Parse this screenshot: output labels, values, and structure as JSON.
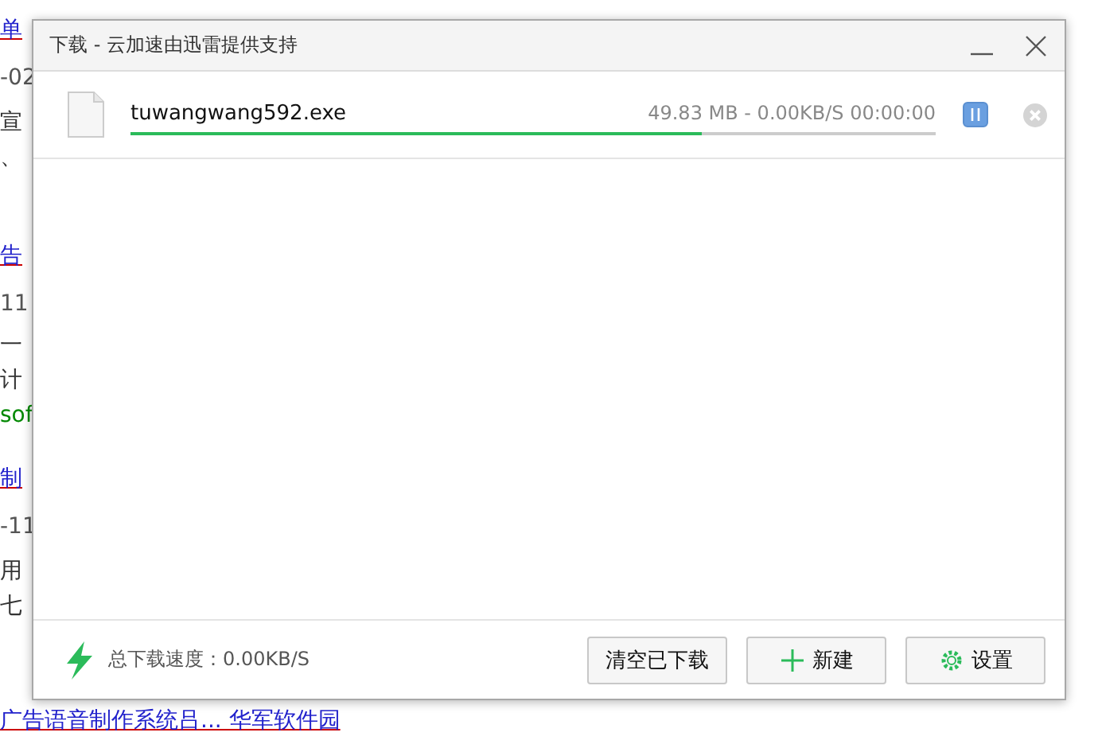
{
  "background_page": {
    "lines": [
      {
        "text": "单",
        "kind": "link"
      },
      {
        "text": "-02",
        "kind": "meta"
      },
      {
        "text": "宣",
        "kind": "text"
      },
      {
        "text": "、",
        "kind": "text"
      },
      {
        "text": "告",
        "kind": "link"
      },
      {
        "text": "11",
        "kind": "meta"
      },
      {
        "text": "一",
        "kind": "text"
      },
      {
        "text": "计",
        "kind": "text"
      },
      {
        "text": "sof",
        "kind": "url"
      },
      {
        "text": "制",
        "kind": "link"
      },
      {
        "text": "-11",
        "kind": "meta"
      },
      {
        "text": "用",
        "kind": "text"
      },
      {
        "text": "七",
        "kind": "text"
      },
      {
        "text": "广告语音制作系统吕... 华军软件园",
        "kind": "link"
      }
    ]
  },
  "window": {
    "title": "下载 - 云加速由迅雷提供支持"
  },
  "downloads": [
    {
      "filename": "tuwangwang592.exe",
      "status": "49.83 MB - 0.00KB/S 00:00:00",
      "level": 0.71,
      "paused": false
    }
  ],
  "footer": {
    "speed": "总下载速度：0.00KB/S",
    "buttons": [
      {
        "label": "清空已下载",
        "kind": "plain"
      },
      {
        "label": "新建",
        "kind": "new"
      },
      {
        "label": "设置",
        "kind": "settings"
      }
    ]
  }
}
